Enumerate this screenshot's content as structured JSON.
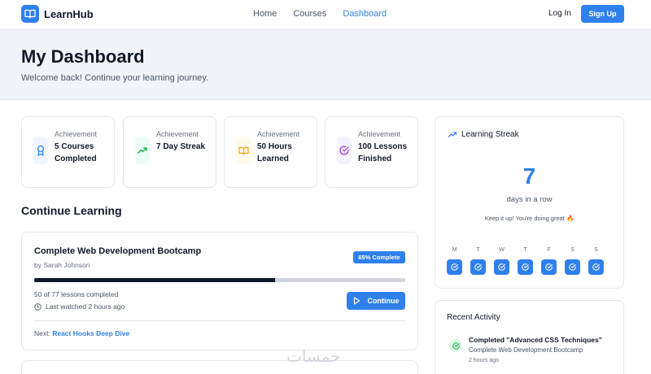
{
  "nav": {
    "brand": "LearnHub",
    "links": [
      "Home",
      "Courses",
      "Dashboard"
    ],
    "active": "Dashboard",
    "login": "Log In",
    "signup": "Sign Up"
  },
  "header": {
    "title": "My Dashboard",
    "subtitle": "Welcome back! Continue your learning journey."
  },
  "achievements": [
    {
      "label": "Achievement",
      "value": "5 Courses Completed",
      "icon": "award-icon",
      "color": "#2f80ed",
      "bg": "#eff6ff"
    },
    {
      "label": "Achievement",
      "value": "7 Day Streak",
      "icon": "trending-up-icon",
      "color": "#16a34a",
      "bg": "#ecfdf5"
    },
    {
      "label": "Achievement",
      "value": "50 Hours Learned",
      "icon": "book-open-icon",
      "color": "#f59e0b",
      "bg": "#fffbeb"
    },
    {
      "label": "Achievement",
      "value": "100 Lessons Finished",
      "icon": "check-circle-icon",
      "color": "#9333ea",
      "bg": "#f5f3ff"
    }
  ],
  "continue_learning": {
    "title": "Continue Learning",
    "course": {
      "title": "Complete Web Development Bootcamp",
      "author": "by Sarah Johnson",
      "badge": "65% Complete",
      "progress": 0.65,
      "lessons": "50 of 77 lessons completed",
      "last_watched": "Last watched 2 hours ago",
      "button": "Continue",
      "next_label": "Next:",
      "next_lesson": "React Hooks Deep Dive"
    }
  },
  "streak": {
    "title": "Learning Streak",
    "count": "7",
    "unit": "days in a row",
    "message": "Keep it up! You're doing great 🔥",
    "days": [
      "M",
      "T",
      "W",
      "T",
      "F",
      "S",
      "S"
    ]
  },
  "activity": {
    "title": "Recent Activity",
    "items": [
      {
        "title": "Completed \"Advanced CSS Techniques\"",
        "course": "Complete Web Development Bootcamp",
        "time": "2 hours ago"
      }
    ]
  },
  "watermark": "خمسات",
  "colors": {
    "accent": "#2f80ed",
    "header_bg": "#f1f5f9"
  }
}
